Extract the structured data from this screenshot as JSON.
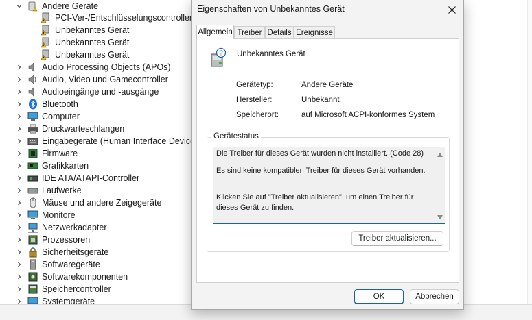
{
  "device_tree": {
    "items": [
      {
        "label": "Andere Geräte",
        "level": 0,
        "expanded": true,
        "icon": "unknown-devices-icon"
      },
      {
        "label": "PCI-Ver-/Entschlüsselungscontroller",
        "level": 1,
        "icon": "warning-device-icon"
      },
      {
        "label": "Unbekanntes Gerät",
        "level": 1,
        "icon": "warning-device-icon"
      },
      {
        "label": "Unbekanntes Gerät",
        "level": 1,
        "icon": "warning-device-icon"
      },
      {
        "label": "Unbekanntes Gerät",
        "level": 1,
        "icon": "warning-device-icon"
      },
      {
        "label": "Audio Processing Objects (APOs)",
        "level": 0,
        "icon": "speaker-icon"
      },
      {
        "label": "Audio, Video und Gamecontroller",
        "level": 0,
        "icon": "speaker-icon"
      },
      {
        "label": "Audioeingänge und -ausgänge",
        "level": 0,
        "icon": "speaker-icon"
      },
      {
        "label": "Bluetooth",
        "level": 0,
        "icon": "bluetooth-icon"
      },
      {
        "label": "Computer",
        "level": 0,
        "icon": "monitor-icon"
      },
      {
        "label": "Druckwarteschlangen",
        "level": 0,
        "icon": "printer-icon"
      },
      {
        "label": "Eingabegeräte (Human Interface Devices)",
        "level": 0,
        "icon": "keyboard-icon"
      },
      {
        "label": "Firmware",
        "level": 0,
        "icon": "chip-icon"
      },
      {
        "label": "Grafikkarten",
        "level": 0,
        "icon": "display-adapter-icon"
      },
      {
        "label": "IDE ATA/ATAPI-Controller",
        "level": 0,
        "icon": "controller-icon"
      },
      {
        "label": "Laufwerke",
        "level": 0,
        "icon": "drive-icon"
      },
      {
        "label": "Mäuse und andere Zeigegeräte",
        "level": 0,
        "icon": "mouse-icon"
      },
      {
        "label": "Monitore",
        "level": 0,
        "icon": "monitor-icon"
      },
      {
        "label": "Netzwerkadapter",
        "level": 0,
        "icon": "network-icon"
      },
      {
        "label": "Prozessoren",
        "level": 0,
        "icon": "processor-icon"
      },
      {
        "label": "Sicherheitsgeräte",
        "level": 0,
        "icon": "security-icon"
      },
      {
        "label": "Softwaregeräte",
        "level": 0,
        "icon": "software-device-icon"
      },
      {
        "label": "Softwarekomponenten",
        "level": 0,
        "icon": "software-component-icon"
      },
      {
        "label": "Speichercontroller",
        "level": 0,
        "icon": "storage-icon"
      },
      {
        "label": "Systemgeräte",
        "level": 0,
        "icon": "system-icon"
      }
    ]
  },
  "dialog": {
    "title": "Eigenschaften von Unbekanntes Gerät",
    "tabs": [
      "Allgemein",
      "Treiber",
      "Details",
      "Ereignisse"
    ],
    "active_tab": "Allgemein",
    "device_name": "Unbekanntes Gerät",
    "properties": [
      {
        "label": "Gerätetyp:",
        "value": "Andere Geräte"
      },
      {
        "label": "Hersteller:",
        "value": "Unbekannt"
      },
      {
        "label": "Speicherort:",
        "value": "auf Microsoft ACPI-konformes System"
      }
    ],
    "status_group_title": "Gerätestatus",
    "status_lines": [
      "Die Treiber für dieses Gerät wurden nicht installiert. (Code 28)",
      "Es sind keine kompatiblen Treiber für dieses Gerät vorhanden.",
      "Klicken Sie auf \"Treiber aktualisieren\", um einen Treiber für dieses Gerät zu finden."
    ],
    "update_driver_button": "Treiber aktualisieren...",
    "ok_button": "OK",
    "cancel_button": "Abbrechen"
  },
  "colors": {
    "accent": "#1a5fb4",
    "warning": "#f2b400",
    "dialog_bg": "#f3f3f3"
  }
}
